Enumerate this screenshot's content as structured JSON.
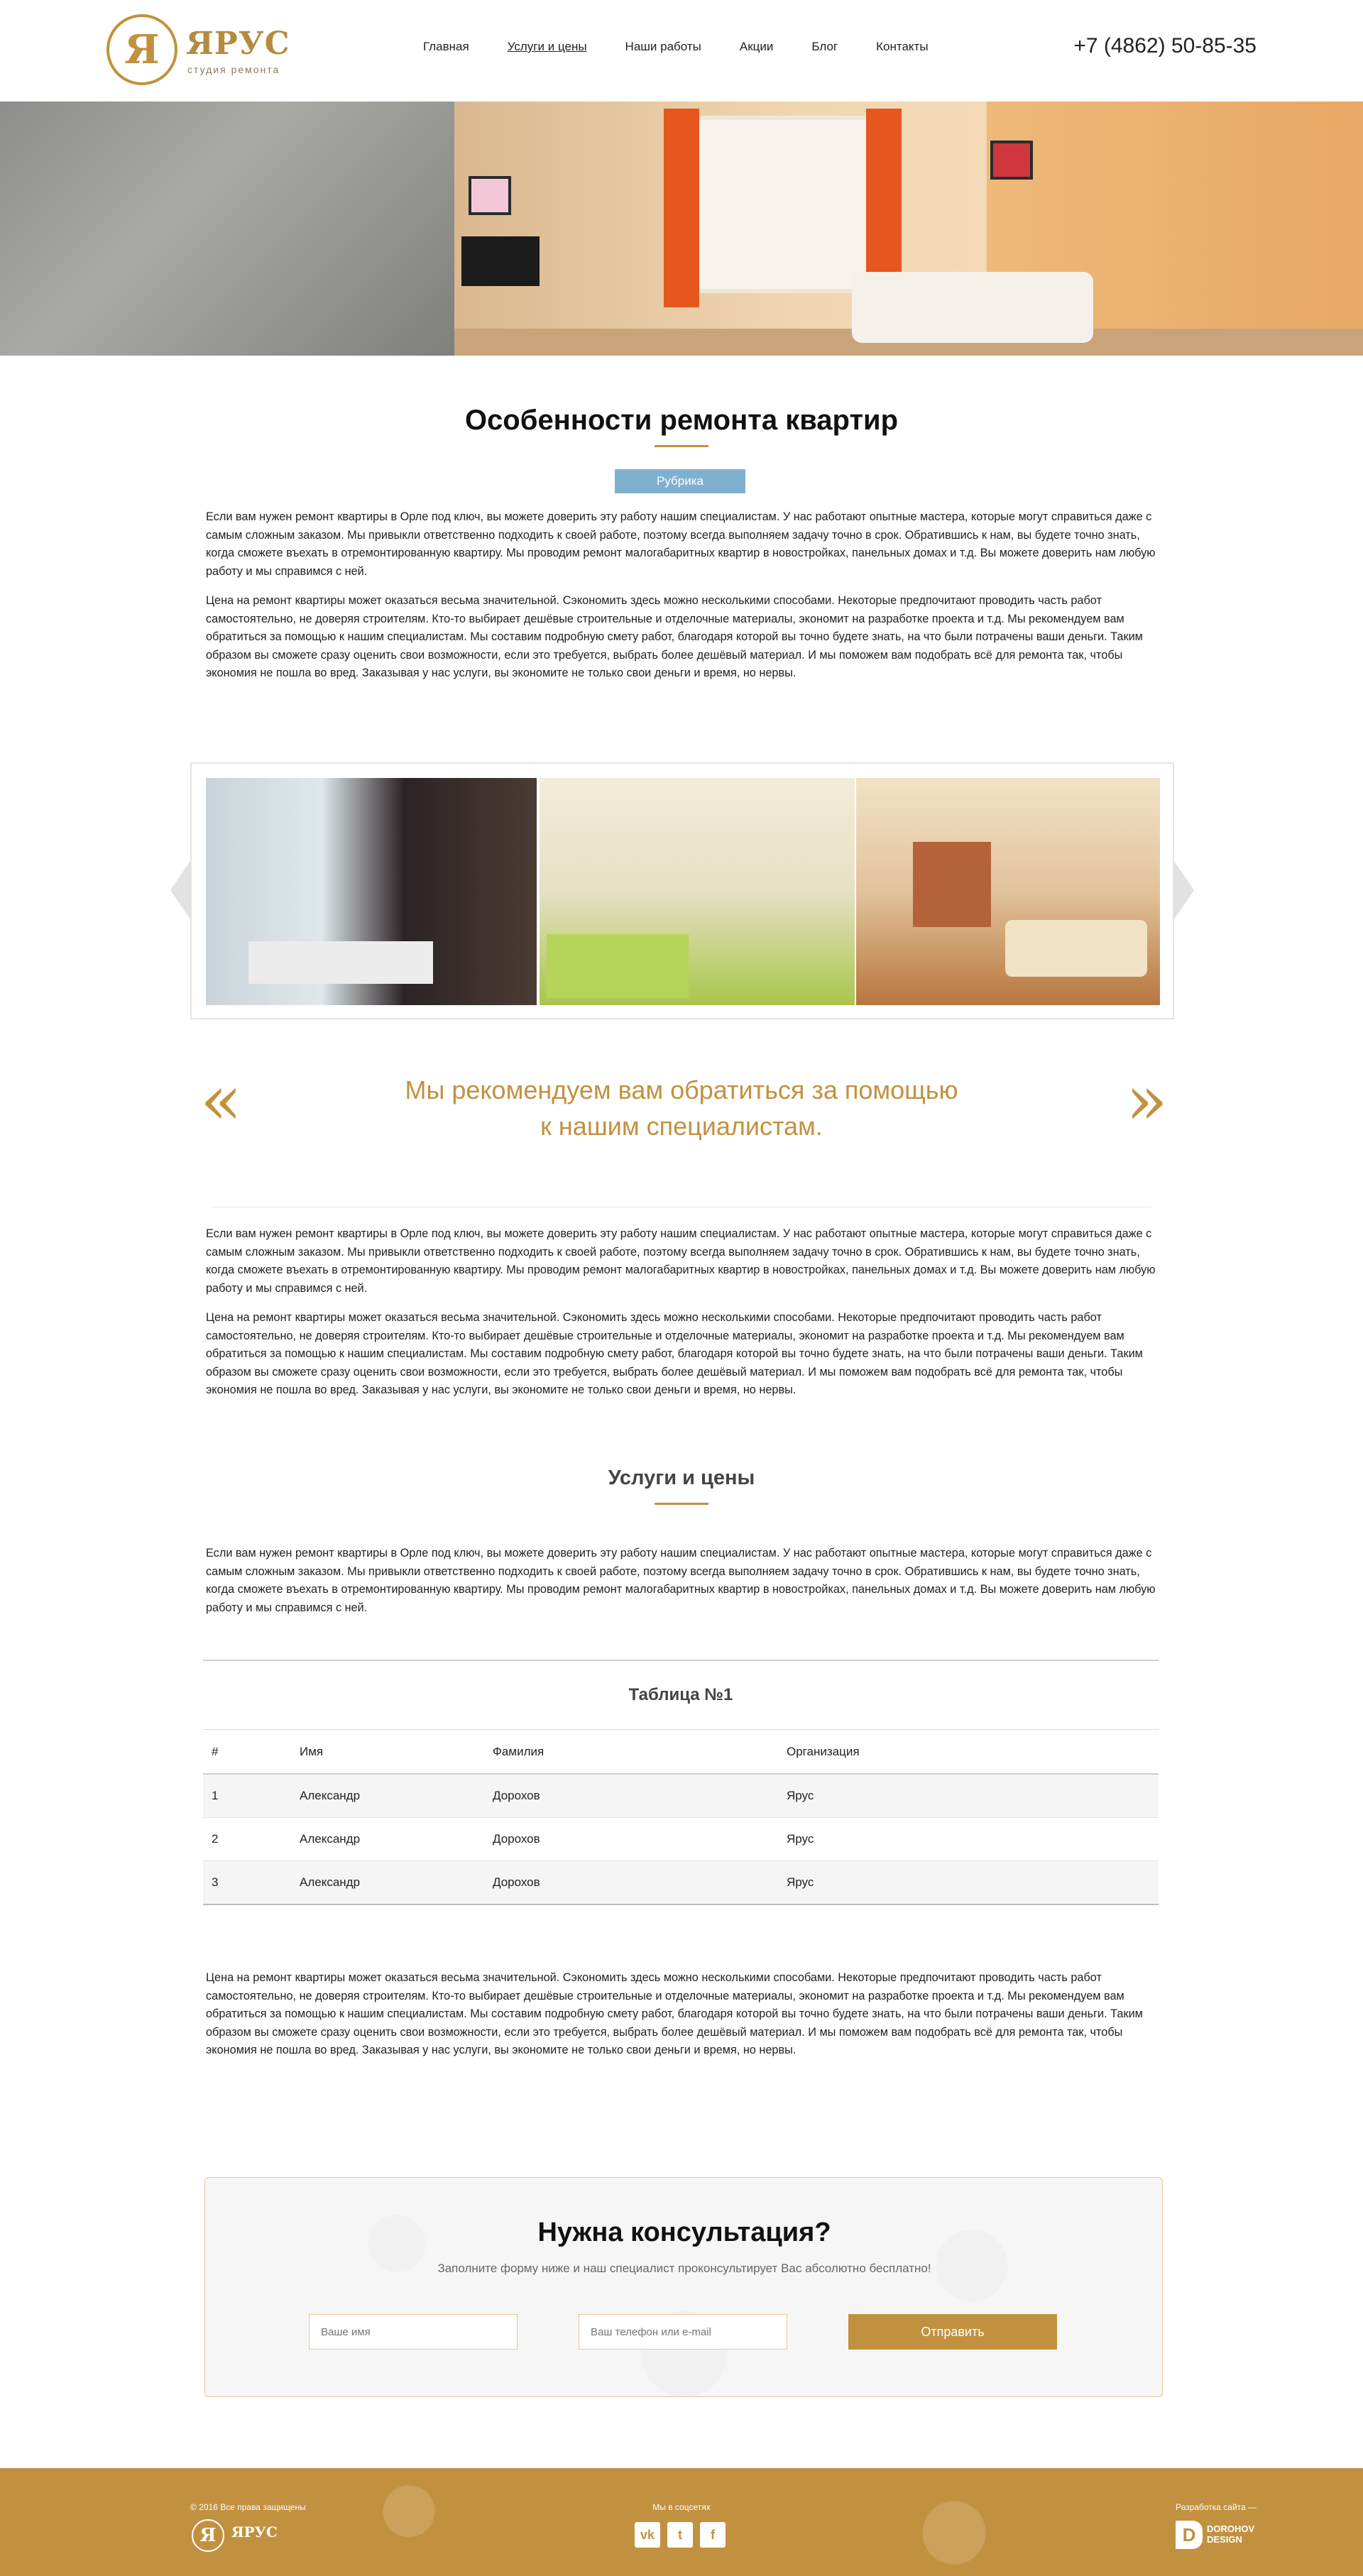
{
  "header": {
    "logo": {
      "mark": "Я",
      "name": "ЯРУС",
      "subtitle": "студия ремонта"
    },
    "nav": [
      {
        "label": "Главная"
      },
      {
        "label": "Услуги и цены",
        "active": true
      },
      {
        "label": "Наши работы"
      },
      {
        "label": "Акции"
      },
      {
        "label": "Блог"
      },
      {
        "label": "Контакты"
      }
    ],
    "phone": "+7 (4862) 50-85-35"
  },
  "main": {
    "title": "Особенности ремонта квартир",
    "rubric": "Рубрика",
    "para1": "Если вам нужен ремонт квартиры в Орле под ключ, вы можете доверить эту работу нашим специалистам. У нас работают опытные мастера, которые могут справиться даже с самым сложным заказом. Мы привыкли ответственно подходить к своей работе, поэтому всегда выполняем задачу точно в срок. Обратившись к нам, вы будете точно знать, когда сможете въехать в отремонтированную квартиру. Мы проводим ремонт малогабаритных квартир в новостройках, панельных домах и т.д. Вы можете доверить нам любую работу и мы справимся с ней.",
    "para2": "Цена на ремонт квартиры может оказаться весьма значительной. Сэкономить здесь можно несколькими способами. Некоторые предпочитают проводить часть работ самостоятельно, не доверяя строителям. Кто-то выбирает дешёвые строительные и отделочные материалы, экономит на разработке проекта и т.д. Мы рекомендуем вам обратиться за помощью к нашим специалистам. Мы составим подробную смету работ, благодаря которой вы точно будете знать, на что были потрачены ваши деньги. Таким образом вы сможете сразу оценить свои возможности, если это требуется, выбрать более дешёвый материал. И мы поможем вам подобрать всё для ремонта так, чтобы экономия не пошла во вред. Заказывая у нас услуги, вы экономите не только свои деньги и время, но нервы.",
    "quote": {
      "open": "«",
      "close": "»",
      "line1": "Мы рекомендуем вам обратиться за помощью",
      "line2": "к нашим специалистам."
    },
    "para3": "Если вам нужен ремонт квартиры в Орле под ключ, вы можете доверить эту работу нашим специалистам. У нас работают опытные мастера, которые могут справиться даже с самым сложным заказом. Мы привыкли ответственно подходить к своей работе, поэтому всегда выполняем задачу точно в срок. Обратившись к нам, вы будете точно знать, когда сможете въехать в отремонтированную квартиру. Мы проводим ремонт малогабаритных квартир в новостройках, панельных домах и т.д. Вы можете доверить нам любую работу и мы справимся с ней.",
    "para4": "Цена на ремонт квартиры может оказаться весьма значительной. Сэкономить здесь можно несколькими способами. Некоторые предпочитают проводить часть работ самостоятельно, не доверяя строителям. Кто-то выбирает дешёвые строительные и отделочные материалы, экономит на разработке проекта и т.д. Мы рекомендуем вам обратиться за помощью к нашим специалистам. Мы составим подробную смету работ, благодаря которой вы точно будете знать, на что были потрачены ваши деньги. Таким образом вы сможете сразу оценить свои возможности, если это требуется, выбрать более дешёвый материал. И мы поможем вам подобрать всё для ремонта так, чтобы экономия не пошла во вред. Заказывая у нас услуги, вы экономите не только свои деньги и время, но нервы.",
    "services_title": "Услуги и цены",
    "para5": "Если вам нужен ремонт квартиры в Орле под ключ, вы можете доверить эту работу нашим специалистам. У нас работают опытные мастера, которые могут справиться даже с самым сложным заказом. Мы привыкли ответственно подходить к своей работе, поэтому всегда выполняем задачу точно в срок. Обратившись к нам, вы будете точно знать, когда сможете въехать в отремонтированную квартиру. Мы проводим ремонт малогабаритных квартир в новостройках, панельных домах и т.д. Вы можете доверить нам любую работу и мы справимся с ней.",
    "table": {
      "caption": "Таблица №1",
      "headers": [
        "#",
        "Имя",
        "Фамилия",
        "Организация"
      ],
      "rows": [
        [
          "1",
          "Александр",
          "Дорохов",
          "Ярус"
        ],
        [
          "2",
          "Александр",
          "Дорохов",
          "Ярус"
        ],
        [
          "3",
          "Александр",
          "Дорохов",
          "Ярус"
        ]
      ]
    },
    "para6": "Цена на ремонт квартиры может оказаться весьма значительной. Сэкономить здесь можно несколькими способами. Некоторые предпочитают проводить часть работ самостоятельно, не доверяя строителям. Кто-то выбирает дешёвые строительные и отделочные материалы, экономит на разработке проекта и т.д. Мы рекомендуем вам обратиться за помощью к нашим специалистам. Мы составим подробную смету работ, благодаря которой вы точно будете знать, на что были потрачены ваши деньги. Таким образом вы сможете сразу оценить свои возможности, если это требуется, выбрать более дешёвый материал. И мы поможем вам подобрать всё для ремонта так, чтобы экономия не пошла во вред. Заказывая у нас услуги, вы экономите не только свои деньги и время, но нервы."
  },
  "consult": {
    "title": "Нужна консультация?",
    "subtitle": "Заполните форму ниже и наш специалист проконсультирует Вас абсолютно бесплатно!",
    "name_placeholder": "Ваше имя",
    "contact_placeholder": "Ваш телефон или e-mail",
    "submit": "Отправить"
  },
  "footer": {
    "copyright": "© 2016 Все права защищены",
    "social_label": "Мы в соцсетях",
    "social": [
      {
        "icon": "vk-icon",
        "glyph": "vk"
      },
      {
        "icon": "twitter-icon",
        "glyph": "t"
      },
      {
        "icon": "facebook-icon",
        "glyph": "f"
      }
    ],
    "dev_label": "Разработка сайта —",
    "dev_name": "DOROHOV DESIGN",
    "dev_mark": "D"
  },
  "colors": {
    "accent": "#c2913f",
    "rubric": "#7fb0d0"
  }
}
